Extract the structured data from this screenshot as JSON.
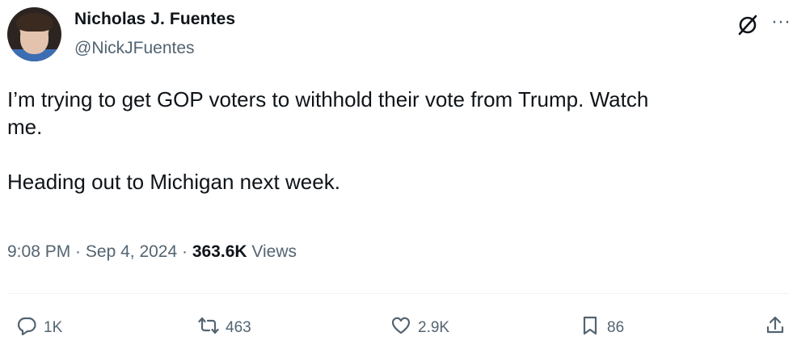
{
  "author": {
    "name": "Nicholas J. Fuentes",
    "handle": "@NickJFuentes",
    "avatar_icon": "avatar-photo"
  },
  "header_icons": {
    "grok": "grok-icon",
    "more": "···"
  },
  "tweet": {
    "text": "I’m trying to get GOP voters to withhold their vote from Trump. Watch\nme.\n\nHeading out to Michigan next week."
  },
  "meta": {
    "time": "9:08 PM",
    "separator": " · ",
    "date": "Sep 4, 2024",
    "views_count": "363.6K",
    "views_label": " Views"
  },
  "actions": {
    "replies": "1K",
    "reposts": "463",
    "likes": "2.9K",
    "bookmarks": "86"
  },
  "colors": {
    "text_primary": "#0f1419",
    "text_secondary": "#536471",
    "divider": "#eff3f4"
  }
}
